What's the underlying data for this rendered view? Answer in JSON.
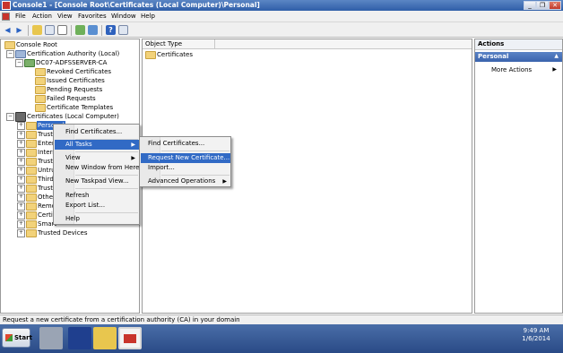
{
  "window": {
    "title": "Console1 - [Console Root\\Certificates (Local Computer)\\Personal]",
    "buttons": {
      "minimize": "_",
      "restore": "❐",
      "close": "✕"
    }
  },
  "menubar": [
    "File",
    "Action",
    "View",
    "Favorites",
    "Window",
    "Help"
  ],
  "toolbar": {
    "icons": [
      "back-arrow-icon",
      "forward-arrow-icon",
      "up-folder-icon",
      "show-hide-tree-icon",
      "export-list-icon",
      "refresh-icon",
      "properties-icon",
      "help-icon",
      "show-hide-action-pane-icon"
    ],
    "glyphs": {
      "back": "◀",
      "forward": "▶",
      "help": "?"
    }
  },
  "tree": {
    "glyphs": {
      "expand": "+",
      "collapse": "−"
    },
    "items": [
      {
        "label": "Console Root"
      },
      {
        "label": "Certification Authority (Local)"
      },
      {
        "label": "DC07-ADFSSERVER-CA"
      },
      {
        "label": "Revoked Certificates"
      },
      {
        "label": "Issued Certificates"
      },
      {
        "label": "Pending Requests"
      },
      {
        "label": "Failed Requests"
      },
      {
        "label": "Certificate Templates"
      },
      {
        "label": "Certificates (Local Computer)"
      },
      {
        "label": "Personal"
      },
      {
        "label": "Truste"
      },
      {
        "label": "Enterp"
      },
      {
        "label": "Interm"
      },
      {
        "label": "Truste"
      },
      {
        "label": "Untrus"
      },
      {
        "label": "Third-F"
      },
      {
        "label": "Truste"
      },
      {
        "label": "Other I"
      },
      {
        "label": "Remot"
      },
      {
        "label": "Certific"
      },
      {
        "label": "Smart"
      },
      {
        "label": "Trusted Devices"
      }
    ]
  },
  "list": {
    "column_header": "Object Type",
    "rows": [
      "Certificates"
    ]
  },
  "actions": {
    "header": "Actions",
    "section": "Personal",
    "items": [
      "More Actions"
    ],
    "glyphs": {
      "section_collapse": "▲",
      "more": "▶"
    }
  },
  "context_menu": {
    "items": [
      "Find Certificates...",
      "All Tasks",
      "View",
      "New Window from Here",
      "New Taskpad View...",
      "Refresh",
      "Export List...",
      "Help"
    ],
    "submenu_glyph": "▶"
  },
  "all_tasks_submenu": {
    "items": [
      "Find Certificates...",
      "Request New Certificate...",
      "Import...",
      "Advanced Operations"
    ]
  },
  "status_bar": {
    "text": "Request a new certificate from a certification authority (CA) in your domain"
  },
  "taskbar": {
    "start_label": "Start",
    "time": "9:49 AM",
    "date": "1/6/2014"
  },
  "colors": {
    "selection": "#316ac5",
    "title_bar": "#2f5ea8",
    "taskbar": "#2a4a86"
  }
}
